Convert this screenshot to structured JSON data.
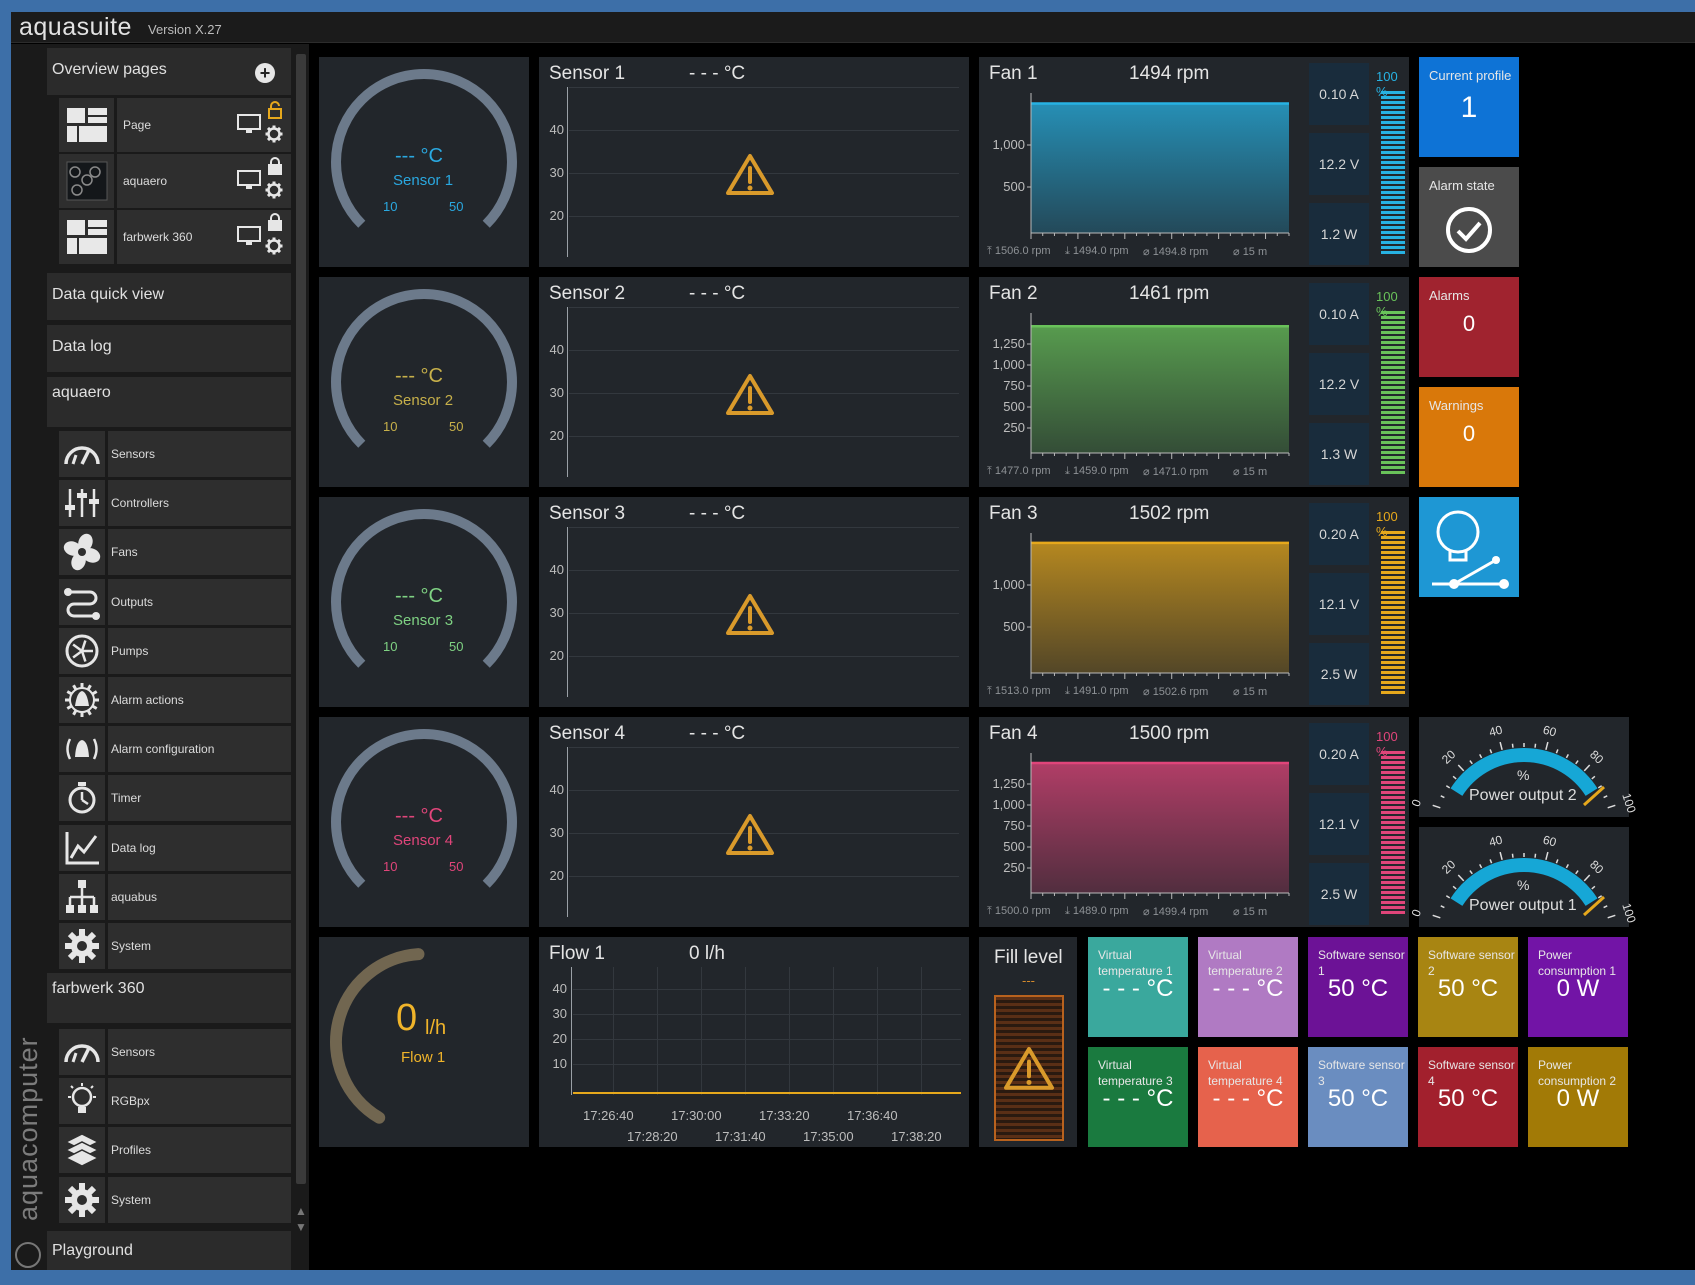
{
  "app": {
    "title": "aquasuite",
    "version": "Version X.27",
    "brand": "aquacomputer"
  },
  "sidebar": {
    "overview": "Overview pages",
    "pages": [
      {
        "label": "Page"
      },
      {
        "label": "aquaero"
      },
      {
        "label": "farbwerk 360"
      }
    ],
    "quick_view": "Data quick view",
    "data_log": "Data log",
    "aquaero": {
      "title": "aquaero",
      "items": [
        "Sensors",
        "Controllers",
        "Fans",
        "Outputs",
        "Pumps",
        "Alarm actions",
        "Alarm configuration",
        "Timer",
        "Data log",
        "aquabus",
        "System"
      ]
    },
    "farbwerk": {
      "title": "farbwerk 360",
      "items": [
        "Sensors",
        "RGBpx",
        "Profiles",
        "System"
      ]
    },
    "playground": "Playground"
  },
  "sensors": [
    {
      "name": "Sensor 1",
      "value": "- - - °C",
      "gauge": "--- °C",
      "min": "10",
      "max": "50",
      "color": "#2aa8e0",
      "y": [
        40,
        30,
        20
      ]
    },
    {
      "name": "Sensor 2",
      "value": "- - - °C",
      "gauge": "--- °C",
      "min": "10",
      "max": "50",
      "color": "#c7b04a",
      "y": [
        40,
        30,
        20
      ]
    },
    {
      "name": "Sensor 3",
      "value": "- - - °C",
      "gauge": "--- °C",
      "min": "10",
      "max": "50",
      "color": "#7fd283",
      "y": [
        40,
        30,
        20
      ]
    },
    {
      "name": "Sensor 4",
      "value": "- - - °C",
      "gauge": "--- °C",
      "min": "10",
      "max": "50",
      "color": "#e0457a",
      "y": [
        40,
        30,
        20
      ]
    }
  ],
  "fans": [
    {
      "name": "Fan 1",
      "rpm": "1494 rpm",
      "current": "0.10 A",
      "voltage": "12.2 V",
      "power": "1.2 W",
      "pct": "100 %",
      "color": "#27b2e3",
      "y": [
        "1,000",
        "500"
      ],
      "stats": [
        "1506.0 rpm",
        "1494.0 rpm",
        "1494.8 rpm"
      ],
      "span": "15 m"
    },
    {
      "name": "Fan 2",
      "rpm": "1461 rpm",
      "current": "0.10 A",
      "voltage": "12.2 V",
      "power": "1.3 W",
      "pct": "100 %",
      "color": "#69c25a",
      "y": [
        "1,250",
        "1,000",
        "750",
        "500",
        "250"
      ],
      "stats": [
        "1477.0 rpm",
        "1459.0 rpm",
        "1471.0 rpm"
      ],
      "span": "15 m"
    },
    {
      "name": "Fan 3",
      "rpm": "1502 rpm",
      "current": "0.20 A",
      "voltage": "12.1 V",
      "power": "2.5 W",
      "pct": "100 %",
      "color": "#e6a81c",
      "y": [
        "1,000",
        "500"
      ],
      "stats": [
        "1513.0 rpm",
        "1491.0 rpm",
        "1502.6 rpm"
      ],
      "span": "15 m"
    },
    {
      "name": "Fan 4",
      "rpm": "1500 rpm",
      "current": "0.20 A",
      "voltage": "12.1 V",
      "power": "2.5 W",
      "pct": "100 %",
      "color": "#e0457a",
      "y": [
        "1,250",
        "1,000",
        "750",
        "500",
        "250"
      ],
      "stats": [
        "1500.0 rpm",
        "1489.0 rpm",
        "1499.4 rpm"
      ],
      "span": "15 m"
    }
  ],
  "flow": {
    "name": "Flow 1",
    "value": "0 l/h",
    "gauge_num": "0",
    "gauge_unit": "l/h",
    "gauge_label": "Flow 1",
    "y": [
      40,
      30,
      20,
      10
    ],
    "x_top": [
      "17:26:40",
      "17:30:00",
      "17:33:20",
      "17:36:40"
    ],
    "x_bot": [
      "17:28:20",
      "17:31:40",
      "17:35:00",
      "17:38:20"
    ]
  },
  "fill": {
    "title": "Fill level",
    "value": "---"
  },
  "status": {
    "profile": {
      "label": "Current profile",
      "value": "1"
    },
    "alarm_state": {
      "label": "Alarm state"
    },
    "alarms": {
      "label": "Alarms",
      "value": "0"
    },
    "warnings": {
      "label": "Warnings",
      "value": "0"
    }
  },
  "power_outputs": [
    {
      "name": "Power output 2",
      "unit": "%",
      "ticks": [
        "0",
        "20",
        "40",
        "60",
        "80",
        "100"
      ]
    },
    {
      "name": "Power output 1",
      "unit": "%",
      "ticks": [
        "0",
        "20",
        "40",
        "60",
        "80",
        "100"
      ]
    }
  ],
  "tiles": [
    {
      "l1": "Virtual",
      "l2": "temperature 1",
      "value": "- - - °C",
      "color": "#3aa89d"
    },
    {
      "l1": "Virtual",
      "l2": "temperature 2",
      "value": "- - - °C",
      "color": "#b07ac3"
    },
    {
      "l1": "Software sensor",
      "l2": "1",
      "value": "50 °C",
      "color": "#6c1296"
    },
    {
      "l1": "Software sensor",
      "l2": "2",
      "value": "50 °C",
      "color": "#a88512"
    },
    {
      "l1": "Power",
      "l2": "consumption 1",
      "value": "0 W",
      "color": "#7214a6"
    },
    {
      "l1": "Virtual",
      "l2": "temperature 3",
      "value": "- - - °C",
      "color": "#1a7a3f"
    },
    {
      "l1": "Virtual",
      "l2": "temperature 4",
      "value": "- - - °C",
      "color": "#e6624c"
    },
    {
      "l1": "Software sensor",
      "l2": "3",
      "value": "50 °C",
      "color": "#6a8dc0"
    },
    {
      "l1": "Software sensor",
      "l2": "4",
      "value": "50 °C",
      "color": "#a2202d"
    },
    {
      "l1": "Power",
      "l2": "consumption 2",
      "value": "0 W",
      "color": "#a27a06"
    }
  ],
  "colors": {
    "accent_blue": "#0e73d6",
    "alarm_red": "#a0232f",
    "warning_orange": "#d9780a",
    "gauge_gray": "#6c7a8b",
    "flow_gauge": "#716650",
    "warning_icon": "#d99a2b"
  }
}
